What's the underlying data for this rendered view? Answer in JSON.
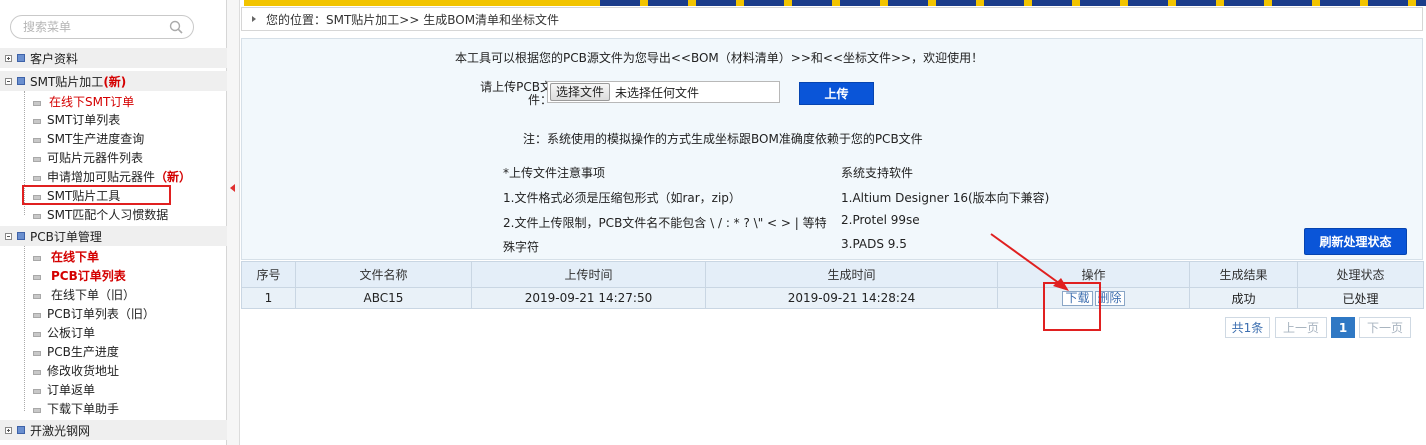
{
  "sidebar": {
    "search_placeholder": "搜索菜单",
    "groups": [
      {
        "label": "客户资料",
        "new_tag": ""
      },
      {
        "label": "SMT贴片加工",
        "new_tag": "(新)"
      },
      {
        "label": "PCB订单管理",
        "new_tag": ""
      },
      {
        "label": "开激光钢网",
        "new_tag": ""
      }
    ],
    "smt_items": [
      {
        "label": "在线下SMT订单",
        "suffix": ""
      },
      {
        "label": "SMT订单列表",
        "suffix": ""
      },
      {
        "label": "SMT生产进度查询",
        "suffix": ""
      },
      {
        "label": "可贴片元器件列表",
        "suffix": ""
      },
      {
        "label": "申请增加可贴元器件",
        "suffix": "（新）"
      },
      {
        "label": "SMT贴片工具",
        "suffix": ""
      },
      {
        "label": "SMT匹配个人习惯数据",
        "suffix": ""
      }
    ],
    "pcb_items": [
      {
        "label": "在线下单"
      },
      {
        "label": "PCB订单列表"
      },
      {
        "label": "在线下单（旧）"
      },
      {
        "label": "PCB订单列表（旧）"
      },
      {
        "label": "公板订单"
      },
      {
        "label": "PCB生产进度"
      },
      {
        "label": "修改收货地址"
      },
      {
        "label": "订单返单"
      },
      {
        "label": "下载下单助手"
      }
    ]
  },
  "breadcrumb": "您的位置：SMT贴片加工>> 生成BOM清单和坐标文件",
  "panel": {
    "intro": "本工具可以根据您的PCB源文件为您导出<<BOM（材料清单）>>和<<坐标文件>>，欢迎使用！",
    "upload_label_1": "请上传PCB文",
    "upload_label_2": "件：",
    "choose_file": "选择文件",
    "no_file": "未选择任何文件",
    "upload_button": "上传",
    "note": "注：系统使用的模拟操作的方式生成坐标跟BOM准确度依赖于您的PCB文件",
    "notice_title": "*上传文件注意事项",
    "notice_1": "1.文件格式必须是压缩包形式（如rar，zip）",
    "notice_2a": "2.文件上传限制，PCB文件名不能包含 \\ / : * ? \\\" < > | 等特",
    "notice_2b": "殊字符",
    "software_title": "系统支持软件",
    "software_1": "1.Altium Designer 16(版本向下兼容)",
    "software_2": "2.Protel 99se",
    "software_3": "3.PADS 9.5",
    "refresh_button": "刷新处理状态"
  },
  "table": {
    "headers": [
      "序号",
      "文件名称",
      "上传时间",
      "生成时间",
      "操作",
      "生成结果",
      "处理状态"
    ],
    "rows": [
      {
        "no": "1",
        "name": "ABC15",
        "upload_time": "2019-09-21 14:27:50",
        "gen_time": "2019-09-21 14:28:24",
        "download": "下载",
        "delete": "删除",
        "result": "成功",
        "status": "已处理"
      }
    ]
  },
  "pagination": {
    "total": "共1条",
    "prev": "上一页",
    "current": "1",
    "next": "下一页"
  },
  "colors": {
    "accent": "#0a55d8",
    "success": "#1c8a1c",
    "new_tag": "#d40000",
    "highlight": "#e02020"
  }
}
